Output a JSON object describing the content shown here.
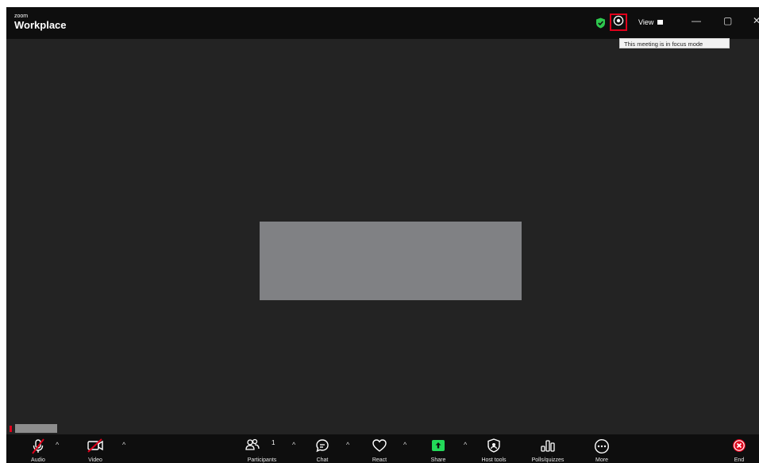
{
  "app": {
    "brand_small": "zoom",
    "brand_name": "Workplace"
  },
  "titlebar": {
    "view_label": "View",
    "minimize_glyph": "—",
    "maximize_glyph": "▢",
    "close_glyph": "✕",
    "tooltip": "This meeting is in focus mode",
    "icons": [
      "security-shield-icon",
      "focus-mode-icon",
      "minimize-icon",
      "maximize-icon",
      "close-icon"
    ]
  },
  "toolbar": {
    "audio": "Audio",
    "video": "Video",
    "participants": "Participants",
    "participants_count": "1",
    "chat": "Chat",
    "react": "React",
    "share": "Share",
    "host_tools": "Host tools",
    "polls": "Polls/quizzes",
    "more": "More",
    "end": "End",
    "caret": "^"
  },
  "colors": {
    "accent_red": "#e0001b",
    "share_green": "#23d959",
    "shield_green": "#2ec84e"
  }
}
